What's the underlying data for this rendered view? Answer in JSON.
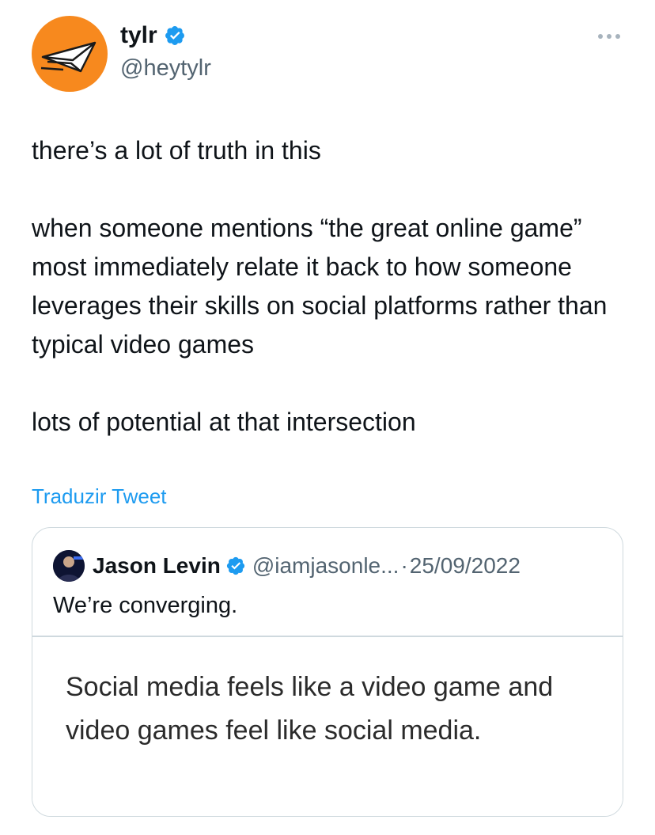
{
  "author": {
    "display_name": "tylr",
    "handle": "@heytylr",
    "avatar_icon": "paper-plane-icon",
    "avatar_color": "#f7891e",
    "verified": true
  },
  "menu": {
    "icon": "more-options-icon"
  },
  "tweet": {
    "line1": "there’s a lot of truth in this",
    "line2": "when someone mentions “the great online game” most immediately relate it back to how someone leverages their skills on social platforms rather than typical video games",
    "line3": "lots of potential at that intersection"
  },
  "translate_label": "Traduzir Tweet",
  "quote": {
    "display_name": "Jason Levin",
    "handle": "@iamjasonle...",
    "separator": "·",
    "date": "25/09/2022",
    "verified": true,
    "text": "We’re converging.",
    "image_text": "Social media feels like a video game and video games feel like social media."
  },
  "colors": {
    "link": "#1d9bf0",
    "verified": "#1d9bf0",
    "secondary_text": "#536471",
    "border": "#cfd9de"
  }
}
